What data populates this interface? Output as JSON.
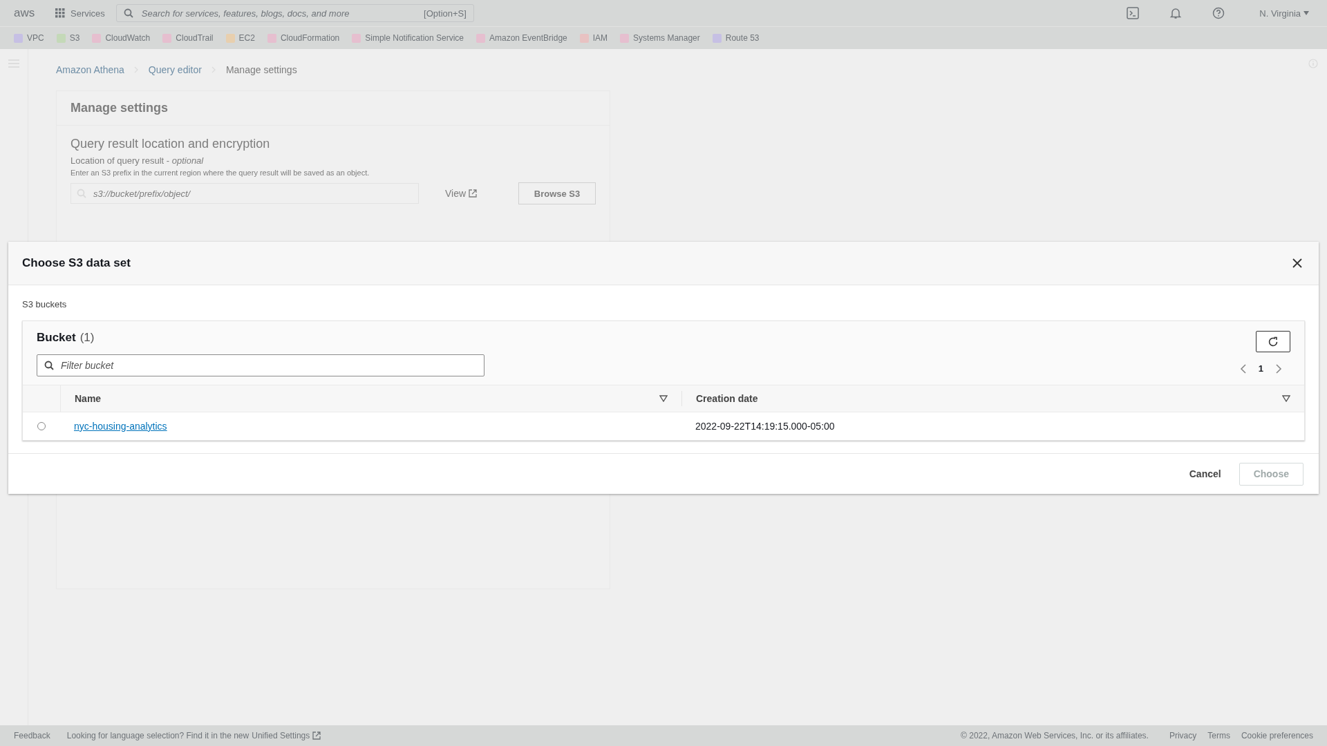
{
  "top_nav": {
    "logo": "aws",
    "services": "Services",
    "search": {
      "placeholder": "Search for services, features, blogs, docs, and more",
      "shortcut": "[Option+S]"
    },
    "region": "N. Virginia"
  },
  "favorites": [
    {
      "label": "VPC",
      "color": "#c6c0e4"
    },
    {
      "label": "S3",
      "color": "#c4d9b8"
    },
    {
      "label": "CloudWatch",
      "color": "#e6bfcf"
    },
    {
      "label": "CloudTrail",
      "color": "#e6bfcf"
    },
    {
      "label": "EC2",
      "color": "#e8cfae"
    },
    {
      "label": "CloudFormation",
      "color": "#e6bfcf"
    },
    {
      "label": "Simple Notification Service",
      "color": "#e6bfcf"
    },
    {
      "label": "Amazon EventBridge",
      "color": "#e6bfcf"
    },
    {
      "label": "IAM",
      "color": "#e8c2c2"
    },
    {
      "label": "Systems Manager",
      "color": "#e6bfcf"
    },
    {
      "label": "Route 53",
      "color": "#c6c0e4"
    }
  ],
  "breadcrumbs": [
    "Amazon Athena",
    "Query editor",
    "Manage settings"
  ],
  "settings": {
    "title": "Manage settings",
    "section_title": "Query result location and encryption",
    "field_label": "Location of query result - *optional*",
    "field_hint": "Enter an S3 prefix in the current region where the query result will be saved as an object.",
    "field": {
      "placeholder": "s3://bucket/prefix/object/"
    },
    "view_link": "View",
    "browse_button": "Browse S3"
  },
  "modal": {
    "title": "Choose S3 data set",
    "section_label": "S3 buckets",
    "table_title": "Bucket",
    "count": "(1)",
    "filter": {
      "placeholder": "Filter bucket"
    },
    "page": "1",
    "columns": [
      "Name",
      "Creation date"
    ],
    "rows": [
      {
        "selected": false,
        "name": "nyc-housing-analytics",
        "created": "2022-09-22T14:19:15.000-05:00"
      }
    ],
    "buttons": [
      {
        "label": "Cancel",
        "kind": "link",
        "disabled": false
      },
      {
        "label": "Choose",
        "kind": "primary",
        "disabled": true
      }
    ]
  },
  "footer": {
    "feedback": "Feedback",
    "notice": "Looking for language selection? Find it in the new",
    "notice_link": "Unified Settings",
    "copyright": "© 2022, Amazon Web Services, Inc. or its affiliates.",
    "links": [
      "Privacy",
      "Terms",
      "Cookie preferences"
    ]
  }
}
